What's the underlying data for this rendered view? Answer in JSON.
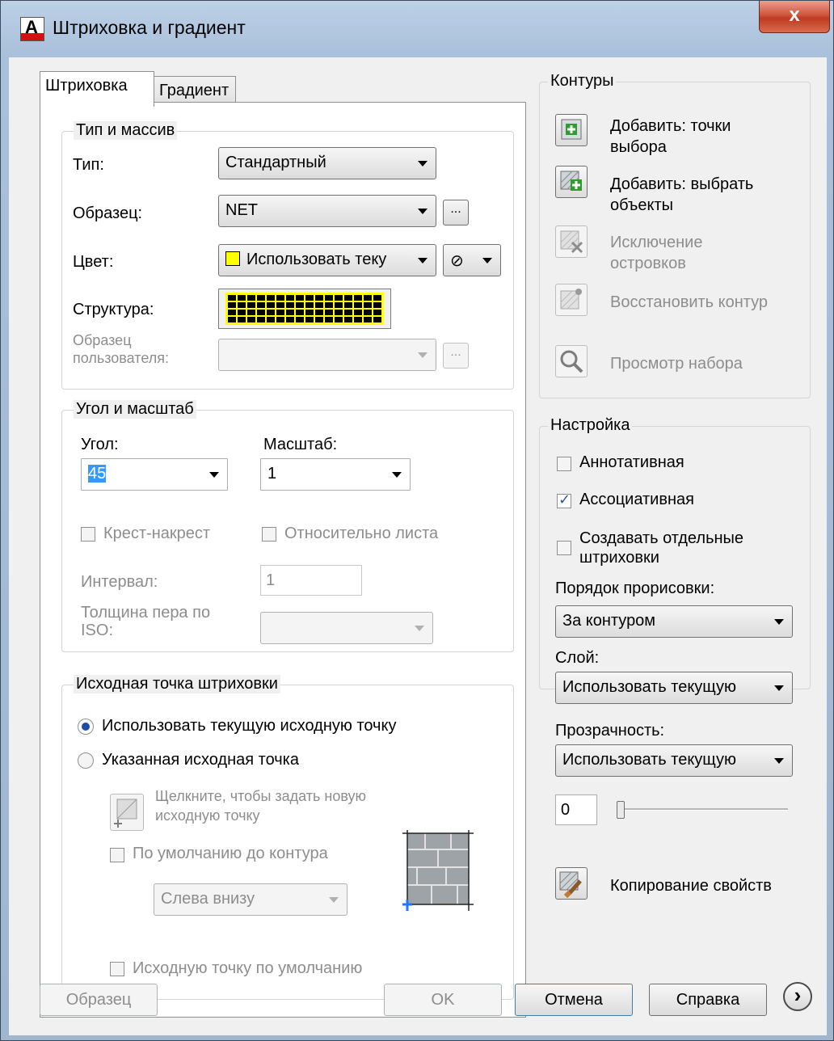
{
  "window": {
    "title": "Штриховка и градиент",
    "app_icon_letter": "A",
    "close_symbol": "x"
  },
  "tabs": [
    {
      "label": "Штриховка",
      "active": true
    },
    {
      "label": "Градиент",
      "active": false
    }
  ],
  "type_group": {
    "title": "Тип и массив",
    "type_label": "Тип:",
    "type_value": "Стандартный",
    "pattern_label": "Образец:",
    "pattern_value": "NET",
    "browse": "...",
    "color_label": "Цвет:",
    "color_value": "Использовать теку",
    "color_swatch": "#ffff00",
    "bg_color_symbol": "⊘",
    "structure_label": "Структура:",
    "custom_label_1": "Образец",
    "custom_label_2": "пользователя:"
  },
  "angle_group": {
    "title": "Угол и масштаб",
    "angle_label": "Угол:",
    "angle_value": "45",
    "scale_label": "Масштаб:",
    "scale_value": "1",
    "double_label": "Крест-накрест",
    "relative_label": "Относительно листа",
    "spacing_label": "Интервал:",
    "spacing_value": "1",
    "iso_label_1": "Толщина пера по",
    "iso_label_2": "ISO:"
  },
  "origin_group": {
    "title": "Исходная точка штриховки",
    "use_current": "Использовать текущую исходную точку",
    "specified": "Указанная исходная точка",
    "click_text_1": "Щелкните, чтобы задать новую",
    "click_text_2": "исходную точку",
    "default_extents": "По умолчанию до контура",
    "position_value": "Слева внизу",
    "store_default": "Исходную точку по умолчанию"
  },
  "boundaries": {
    "title": "Контуры",
    "add_pick_1": "Добавить: точки",
    "add_pick_2": "выбора",
    "add_select_1": "Добавить: выбрать",
    "add_select_2": "объекты",
    "remove_1": "Исключение",
    "remove_2": "островков",
    "recreate": "Восстановить контур",
    "view": "Просмотр набора"
  },
  "options": {
    "title": "Настройка",
    "annotative": "Аннотативная",
    "associative": "Ассоциативная",
    "separate_1": "Создавать отдельные",
    "separate_2": "штриховки",
    "draw_order_label": "Порядок прорисовки:",
    "draw_order_value": "За контуром",
    "layer_label": "Слой:",
    "layer_value": "Использовать текущую",
    "transparency_label": "Прозрачность:",
    "transparency_value": "Использовать текущую",
    "transparency_number": "0",
    "transparency_level": 0
  },
  "inherit": {
    "label": "Копирование свойств"
  },
  "footer": {
    "preview": "Образец",
    "ok": "OK",
    "cancel": "Отмена",
    "help": "Справка",
    "more_symbol": "›"
  }
}
